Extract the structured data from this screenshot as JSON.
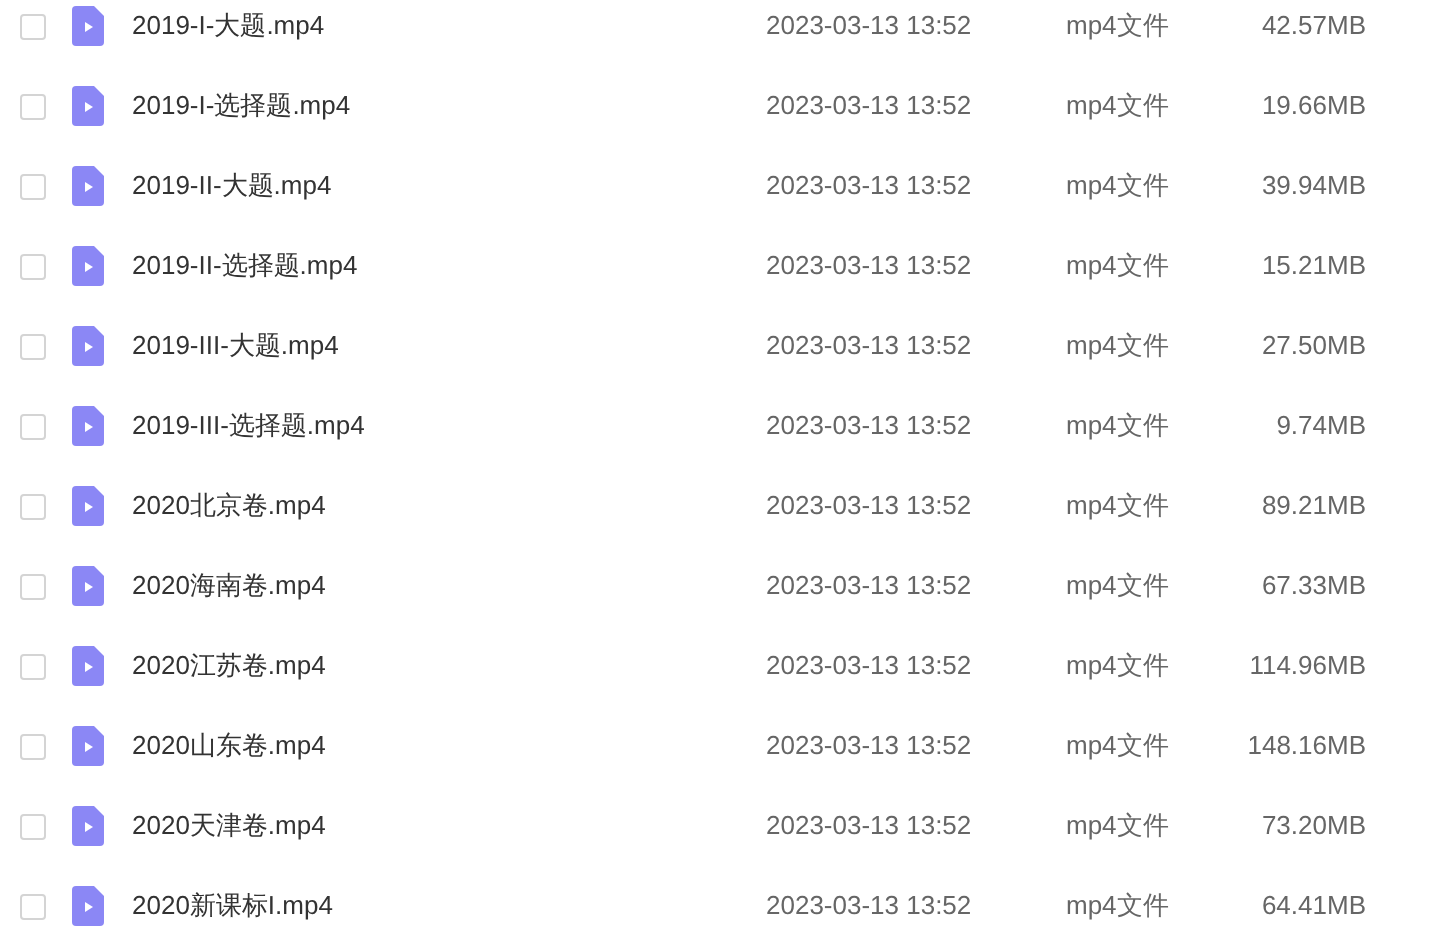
{
  "files": [
    {
      "name": "2019-I-大题.mp4",
      "modified": "2023-03-13 13:52",
      "type": "mp4文件",
      "size": "42.57MB",
      "checked": false
    },
    {
      "name": "2019-I-选择题.mp4",
      "modified": "2023-03-13 13:52",
      "type": "mp4文件",
      "size": "19.66MB",
      "checked": false
    },
    {
      "name": "2019-II-大题.mp4",
      "modified": "2023-03-13 13:52",
      "type": "mp4文件",
      "size": "39.94MB",
      "checked": false
    },
    {
      "name": "2019-II-选择题.mp4",
      "modified": "2023-03-13 13:52",
      "type": "mp4文件",
      "size": "15.21MB",
      "checked": false
    },
    {
      "name": "2019-III-大题.mp4",
      "modified": "2023-03-13 13:52",
      "type": "mp4文件",
      "size": "27.50MB",
      "checked": false
    },
    {
      "name": "2019-III-选择题.mp4",
      "modified": "2023-03-13 13:52",
      "type": "mp4文件",
      "size": "9.74MB",
      "checked": false
    },
    {
      "name": "2020北京卷.mp4",
      "modified": "2023-03-13 13:52",
      "type": "mp4文件",
      "size": "89.21MB",
      "checked": false
    },
    {
      "name": "2020海南卷.mp4",
      "modified": "2023-03-13 13:52",
      "type": "mp4文件",
      "size": "67.33MB",
      "checked": false
    },
    {
      "name": "2020江苏卷.mp4",
      "modified": "2023-03-13 13:52",
      "type": "mp4文件",
      "size": "114.96MB",
      "checked": false
    },
    {
      "name": "2020山东卷.mp4",
      "modified": "2023-03-13 13:52",
      "type": "mp4文件",
      "size": "148.16MB",
      "checked": false
    },
    {
      "name": "2020天津卷.mp4",
      "modified": "2023-03-13 13:52",
      "type": "mp4文件",
      "size": "73.20MB",
      "checked": false
    },
    {
      "name": "2020新课标I.mp4",
      "modified": "2023-03-13 13:52",
      "type": "mp4文件",
      "size": "64.41MB",
      "checked": false
    }
  ]
}
